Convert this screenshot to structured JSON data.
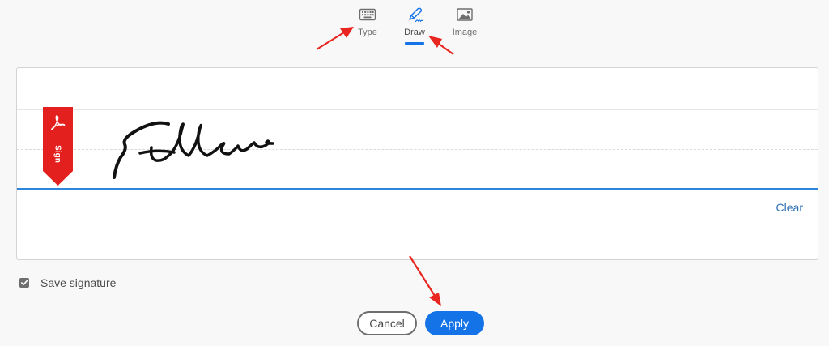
{
  "tabs": [
    {
      "label": "Type",
      "icon": "keyboard-icon",
      "active": false
    },
    {
      "label": "Draw",
      "icon": "pen-icon",
      "active": true
    },
    {
      "label": "Image",
      "icon": "image-icon",
      "active": false
    }
  ],
  "canvas": {
    "ribbon_text": "Sign",
    "ribbon_icon": "acrobat-logo-icon",
    "clear_label": "Clear"
  },
  "save_signature": {
    "label": "Save signature",
    "checked": true
  },
  "buttons": {
    "cancel_label": "Cancel",
    "apply_label": "Apply"
  },
  "colors": {
    "accent": "#1473e6",
    "ribbon": "#e3201d",
    "annotation_arrows": "#e8261f"
  }
}
